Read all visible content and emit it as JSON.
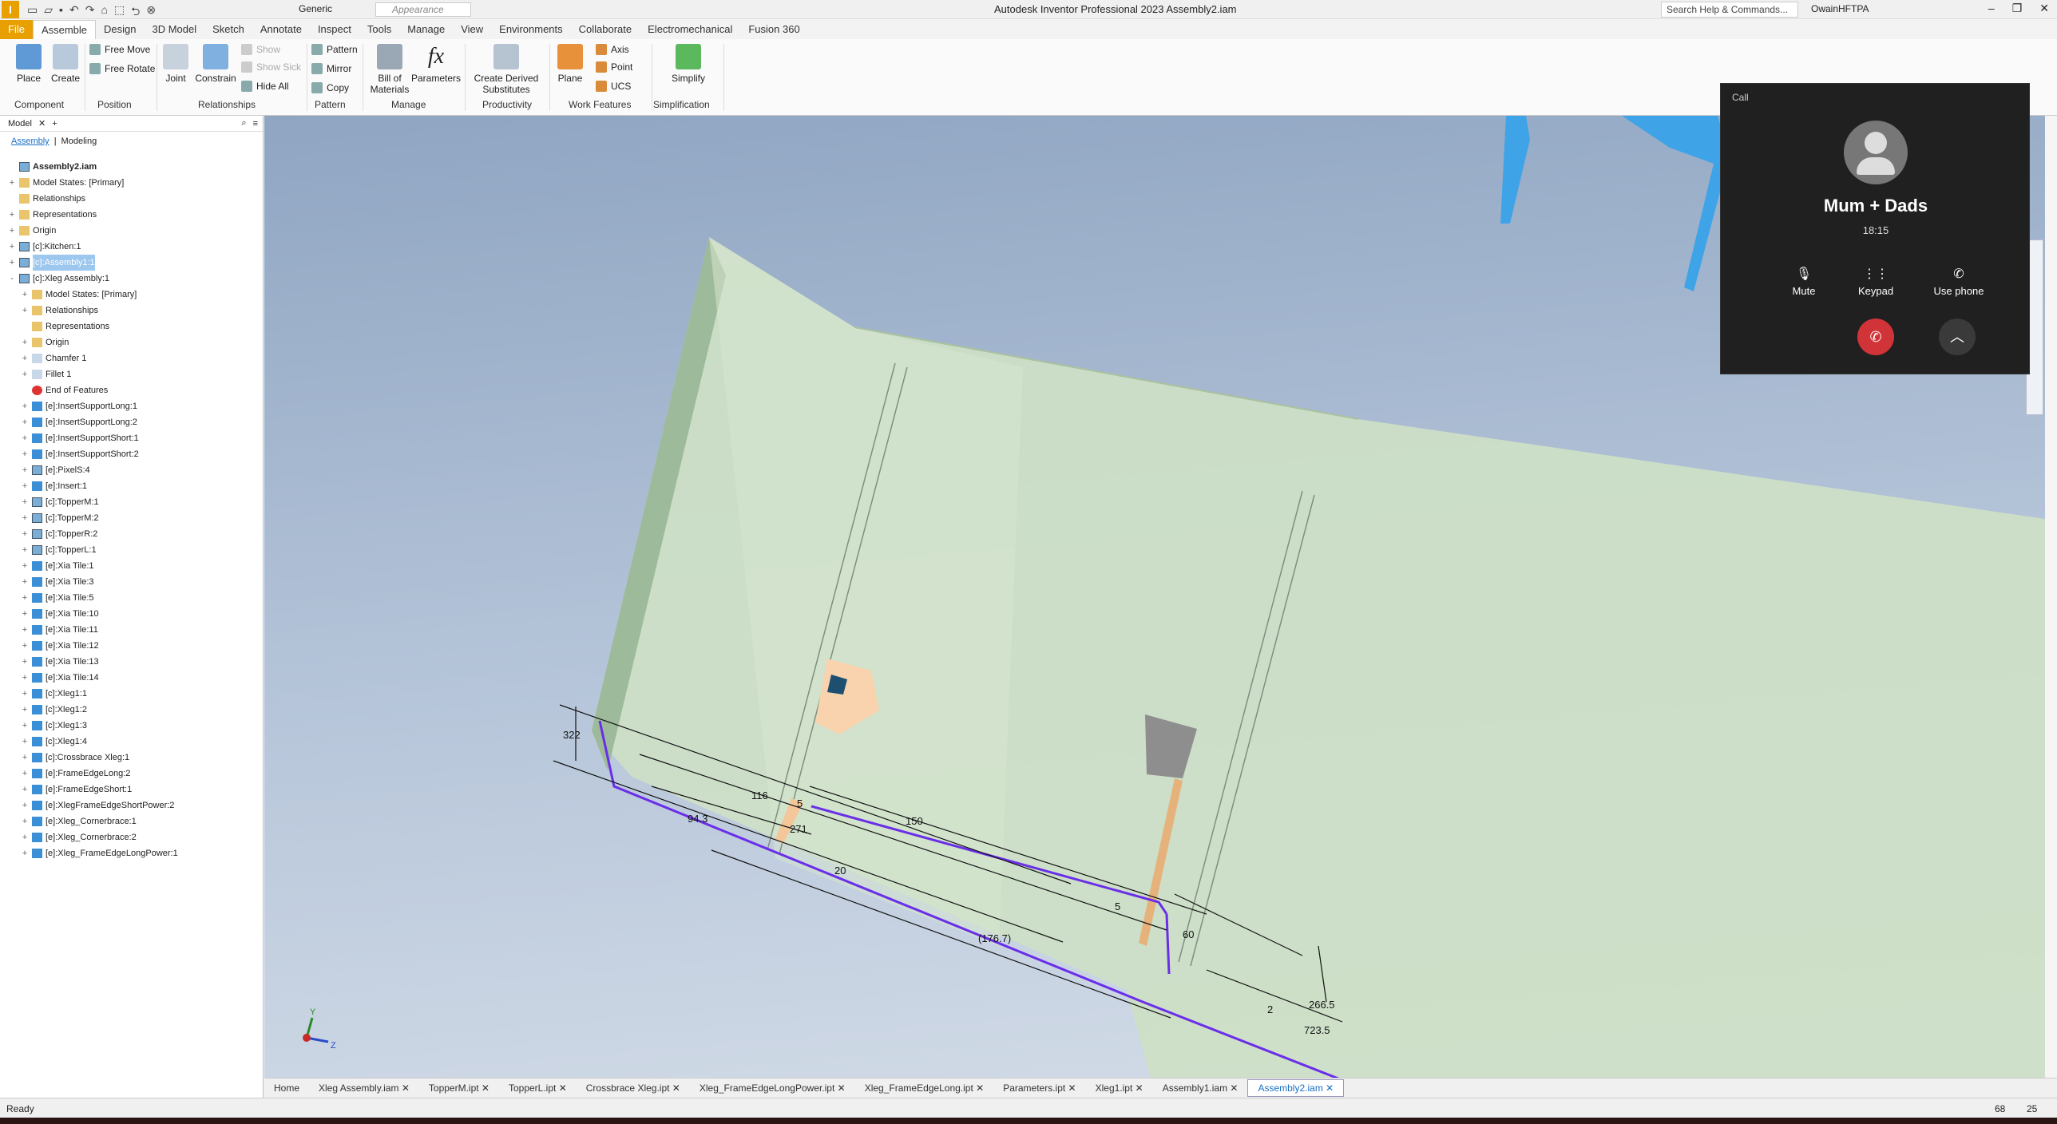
{
  "window": {
    "title": "Autodesk Inventor Professional 2023   Assembly2.iam",
    "material": "Generic",
    "appearance": "Appearance",
    "search_placeholder": "Search Help & Commands...",
    "user": "OwainHFTPA"
  },
  "menu": [
    "File",
    "Assemble",
    "Design",
    "3D Model",
    "Sketch",
    "Annotate",
    "Inspect",
    "Tools",
    "Manage",
    "View",
    "Environments",
    "Collaborate",
    "Electromechanical",
    "Fusion 360"
  ],
  "ribbon": {
    "place": "Place",
    "create": "Create",
    "free_move": "Free Move",
    "free_rotate": "Free Rotate",
    "joint": "Joint",
    "constrain": "Constrain",
    "show": "Show",
    "show_sick": "Show Sick",
    "hide_all": "Hide All",
    "pattern": "Pattern",
    "mirror": "Mirror",
    "copy": "Copy",
    "bom": "Bill of\nMaterials",
    "parameters": "Parameters",
    "derived": "Create Derived\nSubstitutes",
    "plane": "Plane",
    "axis": "Axis",
    "point": "Point",
    "ucs": "UCS",
    "simplify": "Simplify",
    "groups": [
      "Component",
      "Position",
      "Relationships",
      "Pattern",
      "Manage",
      "Productivity",
      "Work Features",
      "Simplification"
    ]
  },
  "browser": {
    "tab": "Model",
    "subtabs": [
      "Assembly",
      "Modeling"
    ],
    "tree": [
      {
        "label": "Assembly2.iam",
        "indent": 0,
        "icon": "asm",
        "exp": "",
        "bold": true
      },
      {
        "label": "Model States: [Primary]",
        "indent": 0,
        "icon": "folder",
        "exp": "+"
      },
      {
        "label": "Relationships",
        "indent": 0,
        "icon": "folder",
        "exp": ""
      },
      {
        "label": "Representations",
        "indent": 0,
        "icon": "folder",
        "exp": "+"
      },
      {
        "label": "Origin",
        "indent": 0,
        "icon": "folder",
        "exp": "+"
      },
      {
        "label": "[c]:Kitchen:1",
        "indent": 0,
        "icon": "asm",
        "exp": "+"
      },
      {
        "label": "[c]:Assembly1:1",
        "indent": 0,
        "icon": "asm",
        "exp": "+",
        "sel": true
      },
      {
        "label": "[c]:Xleg Assembly:1",
        "indent": 0,
        "icon": "asm",
        "exp": "-"
      },
      {
        "label": "Model States: [Primary]",
        "indent": 1,
        "icon": "folder",
        "exp": "+"
      },
      {
        "label": "Relationships",
        "indent": 1,
        "icon": "folder",
        "exp": "+"
      },
      {
        "label": "Representations",
        "indent": 1,
        "icon": "folder",
        "exp": ""
      },
      {
        "label": "Origin",
        "indent": 1,
        "icon": "folder",
        "exp": "+"
      },
      {
        "label": "Chamfer 1",
        "indent": 1,
        "icon": "feat",
        "exp": "+"
      },
      {
        "label": "Fillet 1",
        "indent": 1,
        "icon": "feat",
        "exp": "+"
      },
      {
        "label": "End of Features",
        "indent": 1,
        "icon": "end",
        "exp": ""
      },
      {
        "label": "[e]:InsertSupportLong:1",
        "indent": 1,
        "icon": "part",
        "exp": "+"
      },
      {
        "label": "[e]:InsertSupportLong:2",
        "indent": 1,
        "icon": "part",
        "exp": "+"
      },
      {
        "label": "[e]:InsertSupportShort:1",
        "indent": 1,
        "icon": "part",
        "exp": "+"
      },
      {
        "label": "[e]:InsertSupportShort:2",
        "indent": 1,
        "icon": "part",
        "exp": "+"
      },
      {
        "label": "[e]:PixelS:4",
        "indent": 1,
        "icon": "asm",
        "exp": "+"
      },
      {
        "label": "[e]:Insert:1",
        "indent": 1,
        "icon": "part",
        "exp": "+"
      },
      {
        "label": "[c]:TopperM:1",
        "indent": 1,
        "icon": "asm",
        "exp": "+"
      },
      {
        "label": "[c]:TopperM:2",
        "indent": 1,
        "icon": "asm",
        "exp": "+"
      },
      {
        "label": "[c]:TopperR:2",
        "indent": 1,
        "icon": "asm",
        "exp": "+"
      },
      {
        "label": "[c]:TopperL:1",
        "indent": 1,
        "icon": "asm",
        "exp": "+"
      },
      {
        "label": "[e]:Xia Tile:1",
        "indent": 1,
        "icon": "part",
        "exp": "+"
      },
      {
        "label": "[e]:Xia Tile:3",
        "indent": 1,
        "icon": "part",
        "exp": "+"
      },
      {
        "label": "[e]:Xia Tile:5",
        "indent": 1,
        "icon": "part",
        "exp": "+"
      },
      {
        "label": "[e]:Xia Tile:10",
        "indent": 1,
        "icon": "part",
        "exp": "+"
      },
      {
        "label": "[e]:Xia Tile:11",
        "indent": 1,
        "icon": "part",
        "exp": "+"
      },
      {
        "label": "[e]:Xia Tile:12",
        "indent": 1,
        "icon": "part",
        "exp": "+"
      },
      {
        "label": "[e]:Xia Tile:13",
        "indent": 1,
        "icon": "part",
        "exp": "+"
      },
      {
        "label": "[e]:Xia Tile:14",
        "indent": 1,
        "icon": "part",
        "exp": "+"
      },
      {
        "label": "[c]:Xleg1:1",
        "indent": 1,
        "icon": "part",
        "exp": "+"
      },
      {
        "label": "[c]:Xleg1:2",
        "indent": 1,
        "icon": "part",
        "exp": "+"
      },
      {
        "label": "[c]:Xleg1:3",
        "indent": 1,
        "icon": "part",
        "exp": "+"
      },
      {
        "label": "[c]:Xleg1:4",
        "indent": 1,
        "icon": "part",
        "exp": "+"
      },
      {
        "label": "[c]:Crossbrace Xleg:1",
        "indent": 1,
        "icon": "part",
        "exp": "+"
      },
      {
        "label": "[e]:FrameEdgeLong:2",
        "indent": 1,
        "icon": "part",
        "exp": "+"
      },
      {
        "label": "[e]:FrameEdgeShort:1",
        "indent": 1,
        "icon": "part",
        "exp": "+"
      },
      {
        "label": "[e]:XlegFrameEdgeShortPower:2",
        "indent": 1,
        "icon": "part",
        "exp": "+"
      },
      {
        "label": "[e]:Xleg_Cornerbrace:1",
        "indent": 1,
        "icon": "part",
        "exp": "+"
      },
      {
        "label": "[e]:Xleg_Cornerbrace:2",
        "indent": 1,
        "icon": "part",
        "exp": "+"
      },
      {
        "label": "[e]:Xleg_FrameEdgeLongPower:1",
        "indent": 1,
        "icon": "part",
        "exp": "+"
      }
    ]
  },
  "dimensions": [
    "322",
    "116",
    "94.3",
    "271",
    "150",
    "20",
    "(176.7)",
    "60",
    "266.5",
    "2",
    "723.5",
    "5",
    "5"
  ],
  "axes": {
    "y": "Y",
    "z": "Z"
  },
  "doc_tabs": [
    "Home",
    "Xleg Assembly.iam",
    "TopperM.ipt",
    "TopperL.ipt",
    "Crossbrace Xleg.ipt",
    "Xleg_FrameEdgeLongPower.ipt",
    "Xleg_FrameEdgeLong.ipt",
    "Parameters.ipt",
    "Xleg1.ipt",
    "Assembly1.iam",
    "Assembly2.iam"
  ],
  "active_doc_tab": "Assembly2.iam",
  "status": {
    "text": "Ready",
    "num1": "68",
    "num2": "25"
  },
  "call": {
    "label": "Call",
    "name": "Mum + Dads",
    "time": "18:15",
    "mute": "Mute",
    "keypad": "Keypad",
    "use_phone": "Use phone",
    "hangup_color": "#d13438"
  }
}
